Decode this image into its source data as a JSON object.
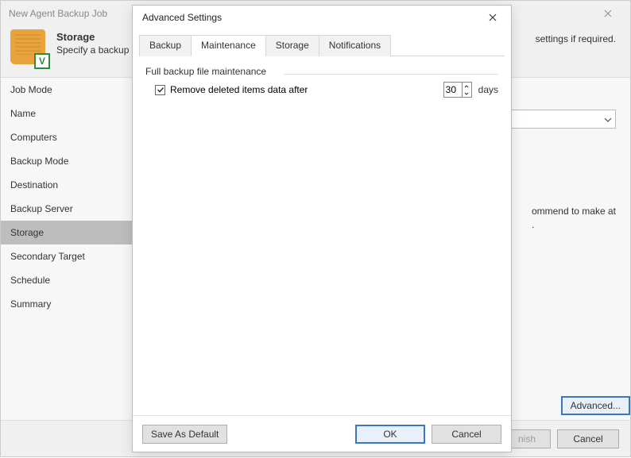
{
  "wizard": {
    "title": "New Agent Backup Job",
    "heading": "Storage",
    "subheading_left": "Specify a backup",
    "subheading_right": "settings if required.",
    "side_items": [
      "Job Mode",
      "Name",
      "Computers",
      "Backup Mode",
      "Destination",
      "Backup Server",
      "Storage",
      "Secondary Target",
      "Schedule",
      "Summary"
    ],
    "selected_side_index": 6,
    "partial_hint": "ommend to make at\n.",
    "footer": {
      "advanced": "Advanced...",
      "finish": "nish",
      "cancel": "Cancel"
    }
  },
  "modal": {
    "title": "Advanced Settings",
    "tabs": [
      "Backup",
      "Maintenance",
      "Storage",
      "Notifications"
    ],
    "active_tab_index": 1,
    "fieldset_label": "Full backup file maintenance",
    "remove_deleted_label": "Remove deleted items data after",
    "remove_deleted_checked": true,
    "days_value": "30",
    "days_label": "days",
    "footer": {
      "save_default": "Save As Default",
      "ok": "OK",
      "cancel": "Cancel"
    }
  }
}
